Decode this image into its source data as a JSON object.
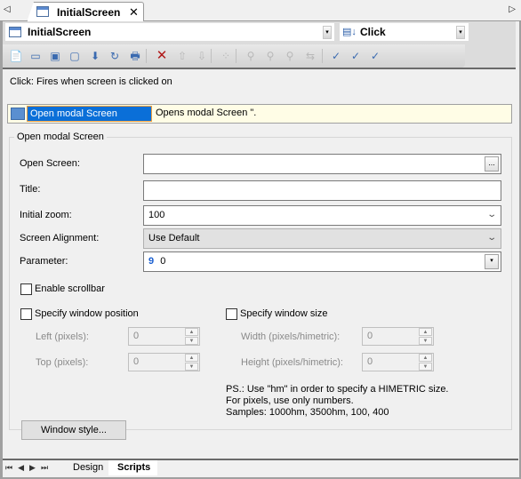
{
  "tabs": {
    "document_tab": "InitialScreen",
    "close_glyph": "✕",
    "scroll_left_glyph": "◁",
    "scroll_right_glyph": "▷"
  },
  "header": {
    "object_selector": "InitialScreen",
    "event_selector": "Click",
    "dropdown_glyph": "▾"
  },
  "toolbar": {
    "buttons": [
      {
        "icon": "add-script-icon",
        "glyph": "📄",
        "enabled": true
      },
      {
        "icon": "add-screen-icon",
        "glyph": "▭",
        "enabled": true
      },
      {
        "icon": "add-modal-screen-icon",
        "glyph": "▣",
        "enabled": true
      },
      {
        "icon": "add-window-icon",
        "glyph": "▢",
        "enabled": true
      },
      {
        "icon": "add-download-icon",
        "glyph": "⬇",
        "enabled": true
      },
      {
        "icon": "add-toggle-icon",
        "glyph": "↻",
        "enabled": true
      },
      {
        "icon": "add-print-icon",
        "glyph": "🖶",
        "enabled": true
      },
      {
        "icon": "delete-icon",
        "glyph": "✕",
        "enabled": true
      },
      {
        "icon": "move-up-icon",
        "glyph": "⇧",
        "enabled": false
      },
      {
        "icon": "move-down-icon",
        "glyph": "⇩",
        "enabled": false
      },
      {
        "icon": "properties-icon",
        "glyph": "⁘",
        "enabled": false
      },
      {
        "icon": "find-icon",
        "glyph": "⚲",
        "enabled": false
      },
      {
        "icon": "find-previous-icon",
        "glyph": "⚲",
        "enabled": false
      },
      {
        "icon": "find-next-icon",
        "glyph": "⚲",
        "enabled": false
      },
      {
        "icon": "replace-icon",
        "glyph": "⇆",
        "enabled": false
      },
      {
        "icon": "verify-icon",
        "glyph": "✓",
        "enabled": true
      },
      {
        "icon": "verify-all-icon",
        "glyph": "✓",
        "enabled": true
      },
      {
        "icon": "verify-project-icon",
        "glyph": "✓",
        "enabled": true
      }
    ]
  },
  "event_description": "Click: Fires when screen is clicked on",
  "actions": [
    {
      "name": "Open modal Screen",
      "description": "Opens modal Screen \"."
    }
  ],
  "form": {
    "group_title": "Open modal Screen",
    "open_screen": {
      "label": "Open Screen:",
      "value": "",
      "browse": "..."
    },
    "title": {
      "label": "Title:",
      "value": ""
    },
    "initial_zoom": {
      "label": "Initial zoom:",
      "value": "100"
    },
    "screen_alignment": {
      "label": "Screen Alignment:",
      "value": "Use Default"
    },
    "parameter": {
      "label": "Parameter:",
      "type_glyph": "9",
      "value": "0"
    },
    "enable_scrollbar": {
      "label": "Enable scrollbar",
      "checked": false
    },
    "window_position": {
      "label": "Specify window position",
      "checked": false,
      "left": {
        "label": "Left (pixels):",
        "value": "0"
      },
      "top": {
        "label": "Top (pixels):",
        "value": "0"
      }
    },
    "window_size": {
      "label": "Specify window size",
      "checked": false,
      "width": {
        "label": "Width (pixels/himetric):",
        "value": "0"
      },
      "height": {
        "label": "Height (pixels/himetric):",
        "value": "0"
      }
    },
    "note_lines": [
      "PS.: Use \"hm\" in order to specify a HIMETRIC size.",
      "For pixels, use only numbers.",
      "Samples: 1000hm, 3500hm, 100, 400"
    ],
    "window_style_button": "Window style..."
  },
  "bottom": {
    "nav_glyphs": "⏮◀▶⏭",
    "tabs": [
      {
        "label": "Design",
        "active": false
      },
      {
        "label": "Scripts",
        "active": true
      }
    ]
  }
}
